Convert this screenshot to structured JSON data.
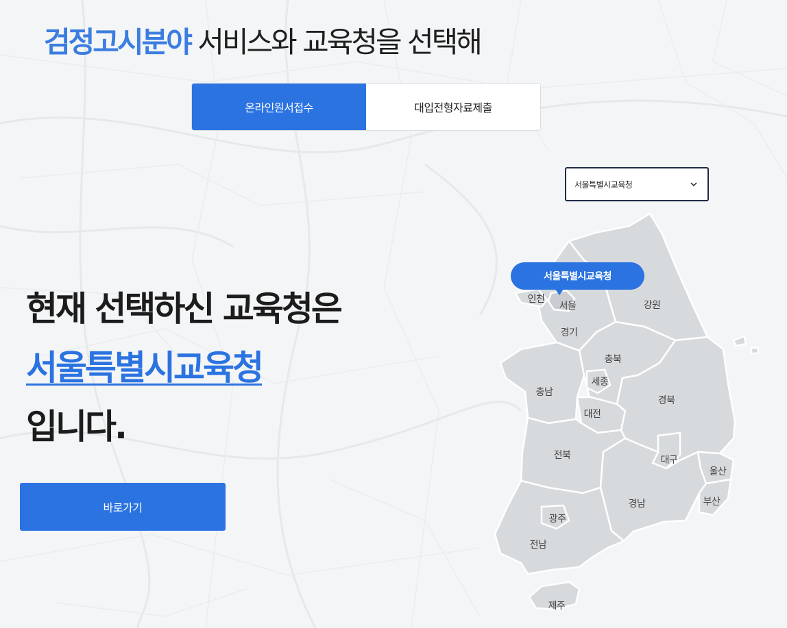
{
  "header": {
    "accent": "검정고시분야",
    "rest": " 서비스와 교육청을 선택해"
  },
  "tabs": [
    {
      "label": "온라인원서접수",
      "active": true
    },
    {
      "label": "대입전형자료제출",
      "active": false
    }
  ],
  "office_select": {
    "value": "서울특별시교육청",
    "icon": "chevron-down-icon"
  },
  "selection": {
    "line1": "현재 선택하신 교육청은",
    "office": "서울특별시교육청",
    "line3": "입니다."
  },
  "go_button": {
    "label": "바로가기"
  },
  "map": {
    "tooltip": "서울특별시교육청",
    "regions": {
      "incheon": "인천",
      "seoul": "서울",
      "gangwon": "강원",
      "gyeonggi": "경기",
      "chungbuk": "충북",
      "sejong": "세종",
      "chungnam": "충남",
      "gyeongbuk": "경북",
      "daejeon": "대전",
      "jeonbuk": "전북",
      "daegu": "대구",
      "ulsan": "울산",
      "gyeongnam": "경남",
      "busan": "부산",
      "gwangju": "광주",
      "jeonnam": "전남",
      "jeju": "제주"
    }
  },
  "colors": {
    "accent": "#2b73e1",
    "headline_accent": "#3b7de0",
    "map_fill": "#d7dadd",
    "background": "#f3f5f6"
  }
}
